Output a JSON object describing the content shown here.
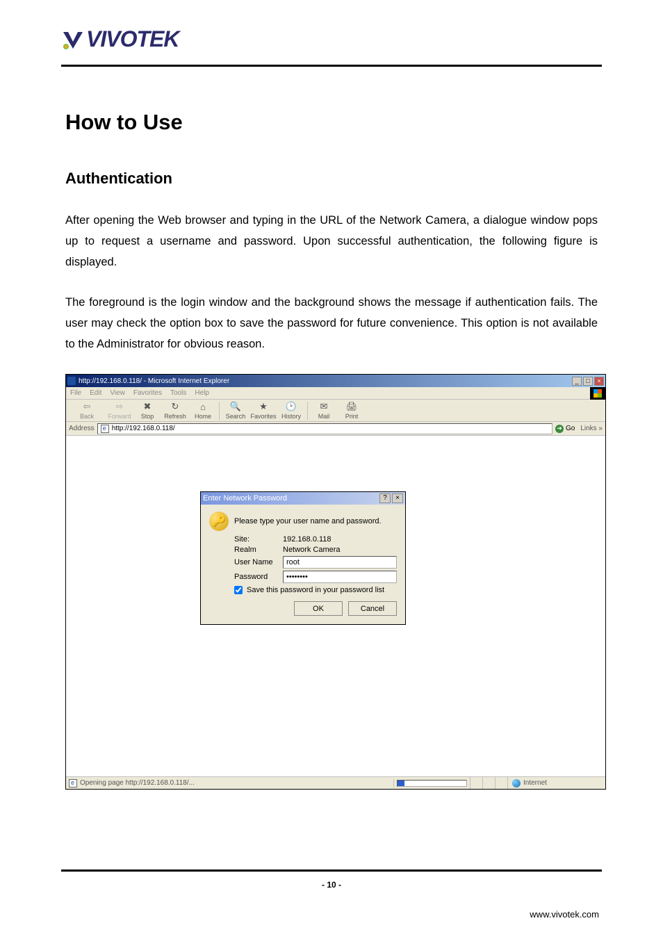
{
  "logo_text": "VIVOTEK",
  "headings": {
    "h1": "How to Use",
    "h2": "Authentication"
  },
  "paragraphs": {
    "p1": "After opening the Web browser and typing in the URL of the Network Camera, a dialogue window pops up to request a username and password. Upon successful authentication, the following figure is displayed.",
    "p2": "The foreground is the login window and the background shows the message if authentication fails. The user may check the option box to save the password for future convenience.   This option is not available to the Administrator for obvious reason."
  },
  "browser": {
    "title": "http://192.168.0.118/ - Microsoft Internet Explorer",
    "menus": {
      "file": "File",
      "edit": "Edit",
      "view": "View",
      "favorites": "Favorites",
      "tools": "Tools",
      "help": "Help"
    },
    "toolbar": {
      "back": "Back",
      "forward": "Forward",
      "stop": "Stop",
      "refresh": "Refresh",
      "home": "Home",
      "search": "Search",
      "favorites": "Favorites",
      "history": "History",
      "mail": "Mail",
      "print": "Print"
    },
    "address_label": "Address",
    "address_value": "http://192.168.0.118/",
    "go_label": "Go",
    "links_label": "Links »",
    "status_text": "Opening page http://192.168.0.118/...",
    "zone": "Internet",
    "win_buttons": {
      "min": "_",
      "max": "□",
      "close": "×"
    }
  },
  "dialog": {
    "title": "Enter Network Password",
    "help_btn": "?",
    "close_btn": "×",
    "prompt": "Please type your user name and password.",
    "site_label": "Site:",
    "site_value": "192.168.0.118",
    "realm_label": "Realm",
    "realm_value": "Network Camera",
    "user_label": "User Name",
    "user_value": "root",
    "password_label": "Password",
    "password_value": "········",
    "save_label": "Save this password in your password list",
    "ok": "OK",
    "cancel": "Cancel"
  },
  "footer": {
    "page_number": "- 10 -",
    "url": "www.vivotek.com"
  }
}
